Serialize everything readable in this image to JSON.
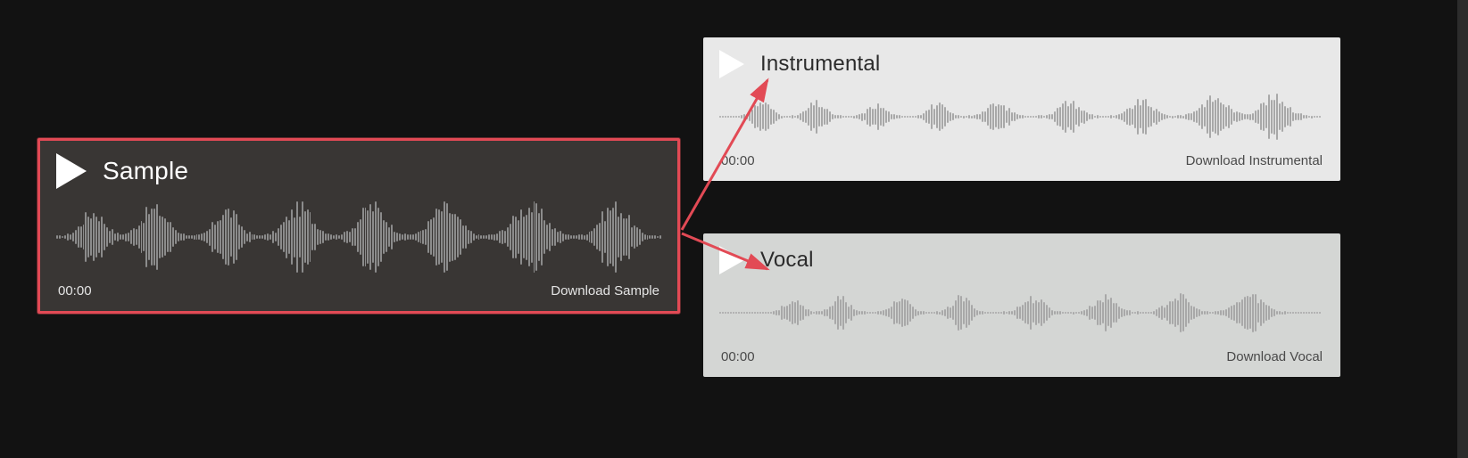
{
  "colors": {
    "highlight_border": "#e24a55",
    "arrow": "#e24a55",
    "bg": "#121212"
  },
  "tracks": {
    "sample": {
      "title": "Sample",
      "time": "00:00",
      "download_label": "Download Sample",
      "theme": "dark"
    },
    "instrumental": {
      "title": "Instrumental",
      "time": "00:00",
      "download_label": "Download Instrumental",
      "theme": "light"
    },
    "vocal": {
      "title": "Vocal",
      "time": "00:00",
      "download_label": "Download Vocal",
      "theme": "light"
    }
  }
}
